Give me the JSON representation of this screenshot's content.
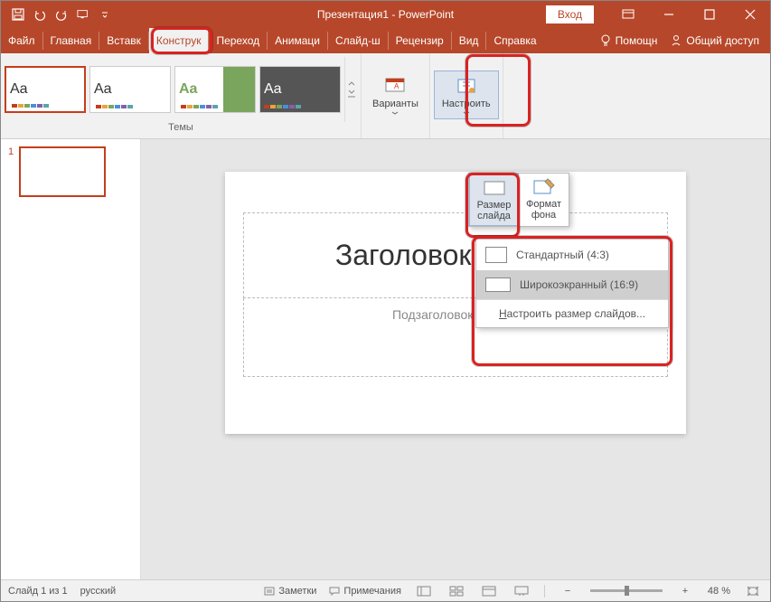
{
  "titlebar": {
    "title": "Презентация1 - PowerPoint",
    "signin": "Вход"
  },
  "tabs": {
    "file": "Файл",
    "home": "Главная",
    "insert": "Вставк",
    "design": "Конструк",
    "transitions": "Переход",
    "animations": "Анимаци",
    "slideshow": "Слайд-ш",
    "review": "Рецензир",
    "view": "Вид",
    "help": "Справка"
  },
  "tabbar_right": {
    "tell_me": "Помощн",
    "share": "Общий доступ"
  },
  "ribbon": {
    "themes_label": "Темы",
    "variants": "Варианты",
    "customize": "Настроить"
  },
  "dropdown": {
    "slide_size": "Размер слайда",
    "format_bg": "Формат фона"
  },
  "size_menu": {
    "standard": "Стандартный (4:3)",
    "widescreen": "Широкоэкранный (16:9)",
    "custom_prefix": "Н",
    "custom_rest": "астроить размер слайдов..."
  },
  "slide": {
    "number": "1",
    "title_placeholder": "Заголовок слайда",
    "subtitle_placeholder": "Подзаголовок слайда"
  },
  "statusbar": {
    "slide_info": "Слайд 1 из 1",
    "language": "русский",
    "notes": "Заметки",
    "comments": "Примечания",
    "zoom": "48 %"
  },
  "colors": {
    "brand": "#B7472A",
    "highlight": "#D92222"
  }
}
